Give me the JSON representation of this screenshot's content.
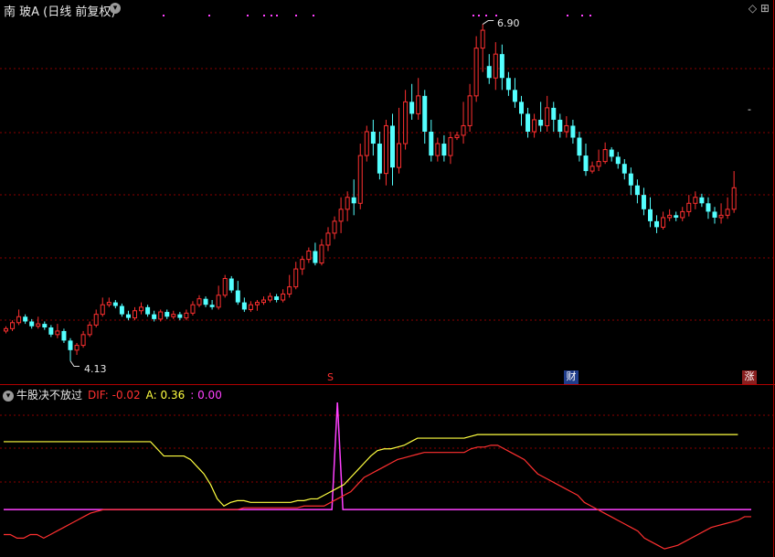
{
  "header": {
    "title": "南 玻A (日线 前复权)",
    "dropdown_icon": "chevron-down-icon",
    "right_icons": "◇ ⊞"
  },
  "main_chart": {
    "high_label": "6.90",
    "low_label": "4.13",
    "right_dash": "-",
    "markers": {
      "s": "S",
      "cai": "财",
      "zhang": "涨"
    },
    "colors": {
      "up": "#ff3030",
      "down": "#54ffff",
      "grid": "#8a0000",
      "dots": "#ff40ff"
    }
  },
  "indicator": {
    "name": "牛股决不放过",
    "dif_label": "DIF: -0.02",
    "a_label": "A: 0.36",
    "c_label": ": 0.00",
    "colors": {
      "dif": "#ff3030",
      "a": "#ffff40",
      "c": "#ff40ff"
    }
  },
  "chart_data": {
    "type": "candlestick",
    "price_range": [
      4.13,
      6.9
    ],
    "candles": [
      [
        4.38,
        4.4,
        4.36,
        4.42
      ],
      [
        4.4,
        4.45,
        4.38,
        4.47
      ],
      [
        4.45,
        4.5,
        4.43,
        4.56
      ],
      [
        4.5,
        4.46,
        4.44,
        4.52
      ],
      [
        4.46,
        4.42,
        4.4,
        4.48
      ],
      [
        4.42,
        4.44,
        4.4,
        4.5
      ],
      [
        4.44,
        4.41,
        4.39,
        4.46
      ],
      [
        4.41,
        4.35,
        4.33,
        4.43
      ],
      [
        4.35,
        4.38,
        4.32,
        4.44
      ],
      [
        4.38,
        4.3,
        4.28,
        4.4
      ],
      [
        4.3,
        4.22,
        4.13,
        4.32
      ],
      [
        4.22,
        4.26,
        4.18,
        4.28
      ],
      [
        4.26,
        4.35,
        4.24,
        4.38
      ],
      [
        4.35,
        4.43,
        4.33,
        4.46
      ],
      [
        4.43,
        4.52,
        4.41,
        4.56
      ],
      [
        4.52,
        4.6,
        4.5,
        4.66
      ],
      [
        4.6,
        4.62,
        4.58,
        4.66
      ],
      [
        4.62,
        4.59,
        4.57,
        4.64
      ],
      [
        4.59,
        4.52,
        4.5,
        4.61
      ],
      [
        4.52,
        4.49,
        4.47,
        4.55
      ],
      [
        4.49,
        4.55,
        4.47,
        4.58
      ],
      [
        4.55,
        4.58,
        4.52,
        4.62
      ],
      [
        4.58,
        4.52,
        4.5,
        4.6
      ],
      [
        4.52,
        4.48,
        4.46,
        4.55
      ],
      [
        4.48,
        4.54,
        4.46,
        4.56
      ],
      [
        4.54,
        4.5,
        4.48,
        4.56
      ],
      [
        4.5,
        4.52,
        4.48,
        4.55
      ],
      [
        4.52,
        4.49,
        4.47,
        4.54
      ],
      [
        4.49,
        4.53,
        4.47,
        4.56
      ],
      [
        4.53,
        4.6,
        4.51,
        4.63
      ],
      [
        4.6,
        4.65,
        4.58,
        4.68
      ],
      [
        4.65,
        4.6,
        4.58,
        4.67
      ],
      [
        4.6,
        4.58,
        4.56,
        4.64
      ],
      [
        4.58,
        4.68,
        4.56,
        4.76
      ],
      [
        4.68,
        4.82,
        4.66,
        4.85
      ],
      [
        4.82,
        4.72,
        4.7,
        4.84
      ],
      [
        4.72,
        4.62,
        4.6,
        4.8
      ],
      [
        4.62,
        4.56,
        4.54,
        4.66
      ],
      [
        4.56,
        4.6,
        4.54,
        4.63
      ],
      [
        4.6,
        4.62,
        4.55,
        4.64
      ],
      [
        4.62,
        4.64,
        4.6,
        4.67
      ],
      [
        4.64,
        4.67,
        4.62,
        4.7
      ],
      [
        4.67,
        4.64,
        4.62,
        4.69
      ],
      [
        4.64,
        4.69,
        4.62,
        4.73
      ],
      [
        4.69,
        4.75,
        4.66,
        4.85
      ],
      [
        4.75,
        4.9,
        4.73,
        4.96
      ],
      [
        4.9,
        4.98,
        4.85,
        5.01
      ],
      [
        4.98,
        5.05,
        4.95,
        5.08
      ],
      [
        5.05,
        4.95,
        4.93,
        5.12
      ],
      [
        4.95,
        5.1,
        4.93,
        5.15
      ],
      [
        5.1,
        5.2,
        5.05,
        5.25
      ],
      [
        5.2,
        5.3,
        5.15,
        5.34
      ],
      [
        5.3,
        5.4,
        5.2,
        5.5
      ],
      [
        5.4,
        5.5,
        5.3,
        5.55
      ],
      [
        5.5,
        5.45,
        5.35,
        5.65
      ],
      [
        5.45,
        5.85,
        5.4,
        5.95
      ],
      [
        5.85,
        6.05,
        5.8,
        6.1
      ],
      [
        6.05,
        5.95,
        5.85,
        6.15
      ],
      [
        5.95,
        5.7,
        5.65,
        6.05
      ],
      [
        5.7,
        6.1,
        5.6,
        6.15
      ],
      [
        6.1,
        5.75,
        5.6,
        6.2
      ],
      [
        5.75,
        5.95,
        5.7,
        6.25
      ],
      [
        5.95,
        6.3,
        5.9,
        6.4
      ],
      [
        6.3,
        6.2,
        6.15,
        6.45
      ],
      [
        6.2,
        6.35,
        6.15,
        6.5
      ],
      [
        6.35,
        6.05,
        5.95,
        6.4
      ],
      [
        6.05,
        5.85,
        5.8,
        6.15
      ],
      [
        5.85,
        5.95,
        5.8,
        6.0
      ],
      [
        5.95,
        5.85,
        5.8,
        6.02
      ],
      [
        5.85,
        6.0,
        5.78,
        6.05
      ],
      [
        6.0,
        6.02,
        5.98,
        6.05
      ],
      [
        6.02,
        6.1,
        5.95,
        6.3
      ],
      [
        6.1,
        6.35,
        6.05,
        6.45
      ],
      [
        6.35,
        6.75,
        6.3,
        6.85
      ],
      [
        6.75,
        6.9,
        6.55,
        6.95
      ],
      [
        6.6,
        6.5,
        6.45,
        6.7
      ],
      [
        6.5,
        6.7,
        6.4,
        6.8
      ],
      [
        6.7,
        6.5,
        6.4,
        6.78
      ],
      [
        6.5,
        6.4,
        6.35,
        6.55
      ],
      [
        6.4,
        6.3,
        6.25,
        6.5
      ],
      [
        6.3,
        6.2,
        6.1,
        6.35
      ],
      [
        6.2,
        6.05,
        6.0,
        6.25
      ],
      [
        6.05,
        6.15,
        6.0,
        6.2
      ],
      [
        6.15,
        6.1,
        6.05,
        6.3
      ],
      [
        6.1,
        6.25,
        6.05,
        6.35
      ],
      [
        6.25,
        6.15,
        6.05,
        6.3
      ],
      [
        6.15,
        6.05,
        6.0,
        6.2
      ],
      [
        6.05,
        6.1,
        6.0,
        6.18
      ],
      [
        6.1,
        6.0,
        5.95,
        6.15
      ],
      [
        6.0,
        5.85,
        5.8,
        6.05
      ],
      [
        5.85,
        5.72,
        5.68,
        5.95
      ],
      [
        5.72,
        5.76,
        5.7,
        5.8
      ],
      [
        5.76,
        5.8,
        5.72,
        5.9
      ],
      [
        5.8,
        5.9,
        5.78,
        5.96
      ],
      [
        5.9,
        5.84,
        5.8,
        5.92
      ],
      [
        5.84,
        5.78,
        5.74,
        5.88
      ],
      [
        5.78,
        5.7,
        5.65,
        5.82
      ],
      [
        5.7,
        5.6,
        5.52,
        5.75
      ],
      [
        5.6,
        5.52,
        5.45,
        5.65
      ],
      [
        5.52,
        5.4,
        5.35,
        5.58
      ],
      [
        5.4,
        5.3,
        5.25,
        5.5
      ],
      [
        5.3,
        5.25,
        5.2,
        5.35
      ],
      [
        5.25,
        5.33,
        5.23,
        5.38
      ],
      [
        5.33,
        5.35,
        5.3,
        5.4
      ],
      [
        5.35,
        5.33,
        5.3,
        5.38
      ],
      [
        5.33,
        5.38,
        5.3,
        5.42
      ],
      [
        5.38,
        5.45,
        5.34,
        5.52
      ],
      [
        5.45,
        5.5,
        5.4,
        5.55
      ],
      [
        5.5,
        5.45,
        5.42,
        5.53
      ],
      [
        5.45,
        5.38,
        5.32,
        5.5
      ],
      [
        5.38,
        5.33,
        5.28,
        5.42
      ],
      [
        5.33,
        5.35,
        5.28,
        5.45
      ],
      [
        5.35,
        5.4,
        5.32,
        5.5
      ],
      [
        5.4,
        5.58,
        5.37,
        5.72
      ]
    ],
    "indicator_range": [
      -0.12,
      0.3
    ],
    "dif": [
      -0.07,
      -0.07,
      -0.08,
      -0.08,
      -0.07,
      -0.07,
      -0.08,
      -0.07,
      -0.06,
      -0.05,
      -0.04,
      -0.03,
      -0.02,
      -0.01,
      -0.005,
      0.0,
      0.0,
      0.0,
      0.0,
      0.0,
      0.0,
      0.0,
      0.0,
      0.0,
      0.0,
      0.0,
      0.0,
      0.0,
      0.0,
      0.0,
      0.0,
      0.0,
      0.0,
      0.0,
      0.0,
      0.0,
      0.005,
      0.005,
      0.005,
      0.005,
      0.005,
      0.005,
      0.005,
      0.005,
      0.005,
      0.01,
      0.01,
      0.01,
      0.01,
      0.02,
      0.03,
      0.04,
      0.05,
      0.07,
      0.09,
      0.1,
      0.11,
      0.12,
      0.13,
      0.14,
      0.145,
      0.15,
      0.155,
      0.16,
      0.16,
      0.16,
      0.16,
      0.16,
      0.16,
      0.16,
      0.17,
      0.175,
      0.175,
      0.18,
      0.18,
      0.17,
      0.16,
      0.15,
      0.14,
      0.12,
      0.1,
      0.09,
      0.08,
      0.07,
      0.06,
      0.05,
      0.04,
      0.02,
      0.01,
      0.0,
      -0.01,
      -0.02,
      -0.03,
      -0.04,
      -0.05,
      -0.06,
      -0.08,
      -0.09,
      -0.1,
      -0.11,
      -0.105,
      -0.1,
      -0.09,
      -0.08,
      -0.07,
      -0.06,
      -0.05,
      -0.045,
      -0.04,
      -0.035,
      -0.03,
      -0.02,
      -0.02
    ],
    "a": [
      0.19,
      0.19,
      0.19,
      0.19,
      0.19,
      0.19,
      0.19,
      0.19,
      0.19,
      0.19,
      0.19,
      0.19,
      0.19,
      0.19,
      0.19,
      0.19,
      0.19,
      0.19,
      0.19,
      0.19,
      0.19,
      0.19,
      0.19,
      0.17,
      0.15,
      0.15,
      0.15,
      0.15,
      0.14,
      0.12,
      0.1,
      0.07,
      0.03,
      0.01,
      0.02,
      0.025,
      0.025,
      0.02,
      0.02,
      0.02,
      0.02,
      0.02,
      0.02,
      0.02,
      0.025,
      0.025,
      0.03,
      0.03,
      0.04,
      0.05,
      0.06,
      0.07,
      0.09,
      0.11,
      0.13,
      0.15,
      0.165,
      0.17,
      0.17,
      0.175,
      0.18,
      0.19,
      0.2,
      0.2,
      0.2,
      0.2,
      0.2,
      0.2,
      0.2,
      0.2,
      0.205,
      0.21,
      0.21,
      0.21,
      0.21,
      0.21,
      0.21,
      0.21,
      0.21,
      0.21,
      0.21,
      0.21,
      0.21,
      0.21,
      0.21,
      0.21,
      0.21,
      0.21,
      0.21,
      0.21,
      0.21,
      0.21,
      0.21,
      0.21,
      0.21,
      0.21,
      0.21,
      0.21,
      0.21,
      0.21,
      0.21,
      0.21,
      0.21,
      0.21,
      0.21,
      0.21,
      0.21,
      0.21,
      0.21,
      0.21,
      0.21
    ],
    "c_zero": 0.0,
    "c_spike": 0.3
  }
}
